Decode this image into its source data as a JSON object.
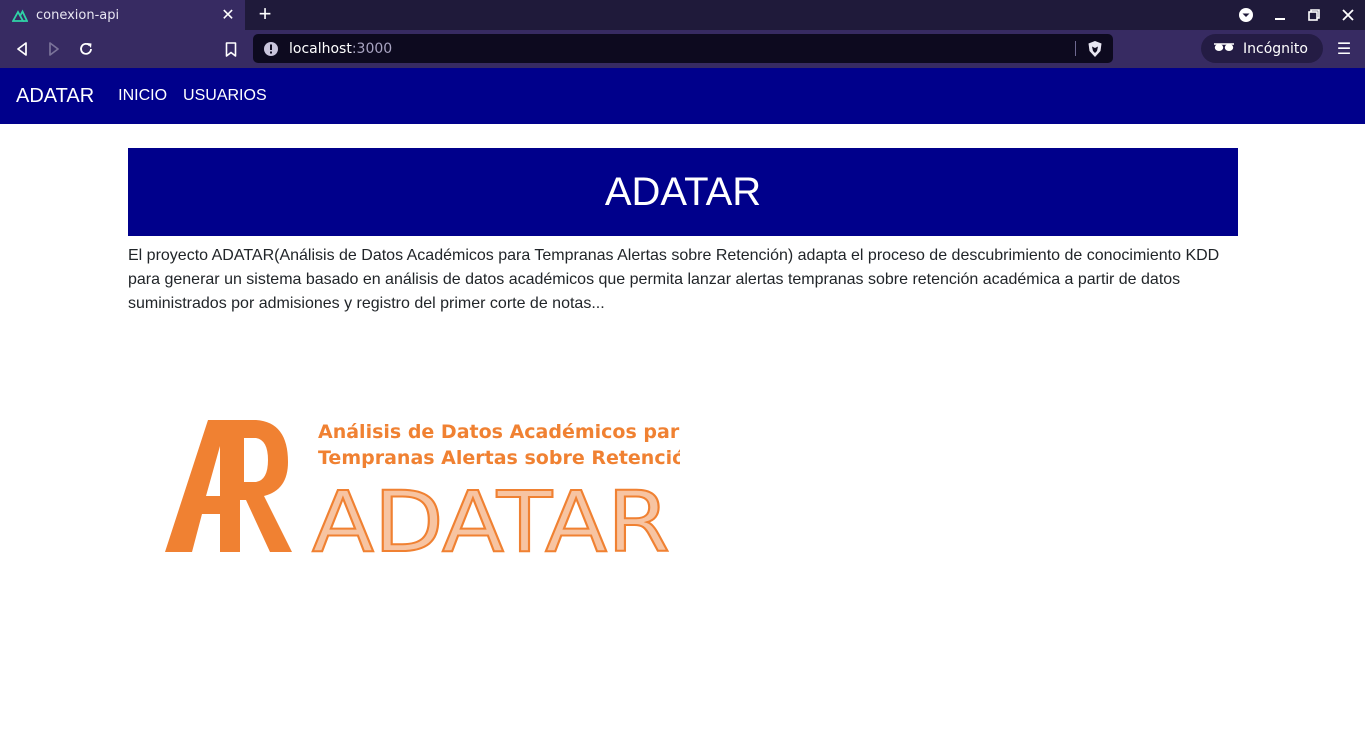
{
  "browser": {
    "tab_title": "conexion-api",
    "tab_close": "✕",
    "new_tab": "+",
    "url_host": "localhost",
    "url_port": ":3000",
    "incognito_label": "Incógnito",
    "menu_glyph": "☰"
  },
  "site": {
    "brand": "ADATAR",
    "nav": [
      {
        "label": "INICIO"
      },
      {
        "label": "USUARIOS"
      }
    ],
    "hero_title": "ADATAR",
    "description": "El proyecto ADATAR(Análisis de Datos Académicos para Tempranas Alertas sobre Retención) adapta el proceso de descubrimiento de conocimiento KDD para generar un sistema basado en análisis de datos académicos que permita lanzar alertas tempranas sobre retención académica a partir de datos suministrados por admisiones y registro del primer corte de notas...",
    "logo": {
      "line1": "Análisis de Datos Académicos para",
      "line2": "Tempranas Alertas sobre Retención",
      "wordmark": "ADATAR"
    }
  },
  "colors": {
    "nav_bg": "#00008b",
    "chrome_bg": "#372b62",
    "logo_orange": "#f08132",
    "logo_light": "#f7c4a2"
  }
}
